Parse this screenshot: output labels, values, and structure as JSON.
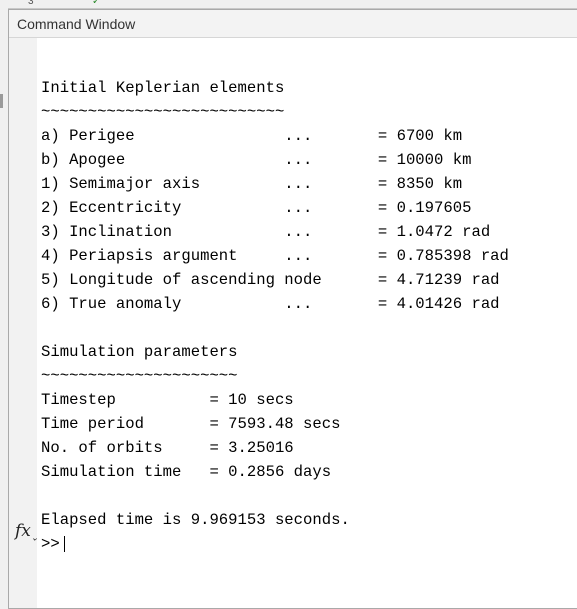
{
  "window": {
    "title": "Command Window"
  },
  "output": {
    "lines": [
      "Initial Keplerian elements",
      "~~~~~~~~~~~~~~~~~~~~~~~~~~",
      "a) Perigee                ...       = 6700 km",
      "b) Apogee                 ...       = 10000 km",
      "1) Semimajor axis         ...       = 8350 km",
      "2) Eccentricity           ...       = 0.197605",
      "3) Inclination            ...       = 1.0472 rad",
      "4) Periapsis argument     ...       = 0.785398 rad",
      "5) Longitude of ascending node      = 4.71239 rad",
      "6) True anomaly           ...       = 4.01426 rad",
      "",
      "Simulation parameters",
      "~~~~~~~~~~~~~~~~~~~~~",
      "Timestep          = 10 secs",
      "Time period       = 7593.48 secs",
      "No. of orbits     = 3.25016",
      "Simulation time   = 0.2856 days",
      "",
      "Elapsed time is 9.969153 seconds."
    ]
  },
  "prompt": {
    "symbol": ">>",
    "fx_label": "fx"
  }
}
